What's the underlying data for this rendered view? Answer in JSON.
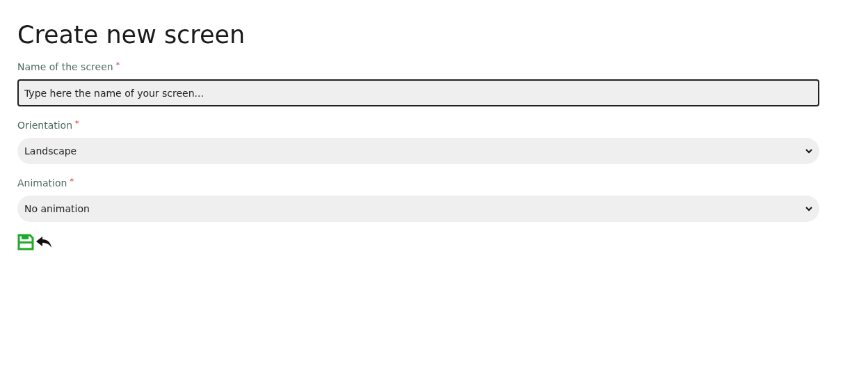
{
  "title": "Create new screen",
  "fields": [
    {
      "kind": "text",
      "label": "Name of the screen",
      "required_mark": "*",
      "placeholder": "Type here the name of your screen...",
      "focused": true
    },
    {
      "kind": "select",
      "label": "Orientation",
      "required_mark": "*",
      "value": "Landscape",
      "focused": false
    },
    {
      "kind": "select",
      "label": "Animation",
      "required_mark": "*",
      "value": "No animation",
      "focused": false
    }
  ],
  "actions": [
    {
      "kind": "save"
    },
    {
      "kind": "back"
    }
  ]
}
